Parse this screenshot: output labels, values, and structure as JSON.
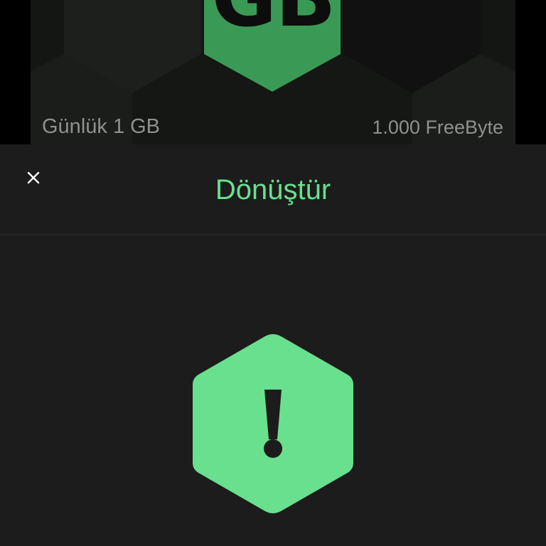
{
  "background_card": {
    "badge_text": "GB",
    "name_label": "Günlük 1 GB",
    "price_label": "1.000 FreeByte",
    "accent_color": "#3a9a55"
  },
  "modal": {
    "title": "Dönüştür",
    "close_icon": "close-icon",
    "status_icon": "warning-hexagon-icon",
    "accent_color": "#68e08e"
  }
}
